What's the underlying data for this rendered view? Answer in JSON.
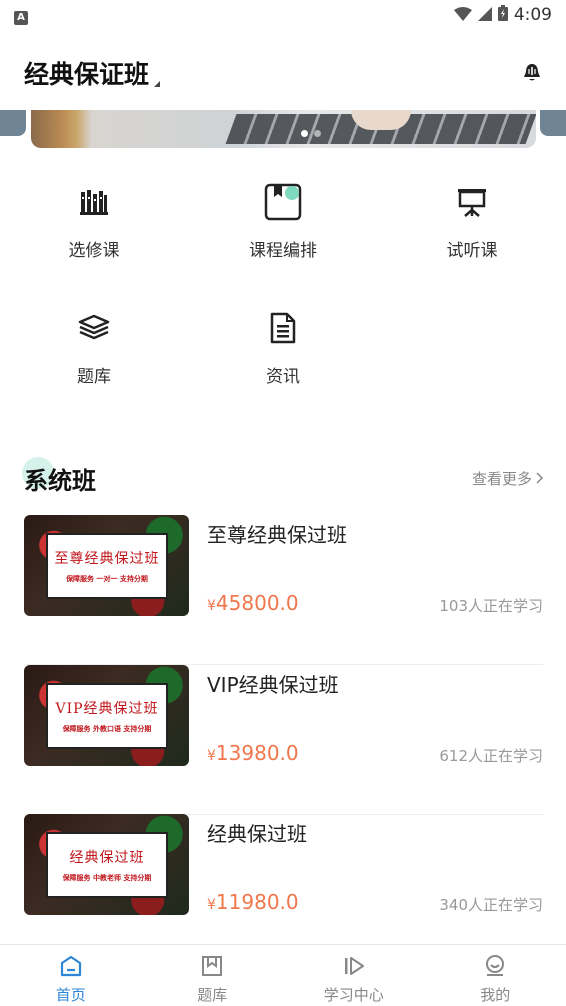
{
  "status_bar": {
    "app_badge": "A",
    "time": "4:09"
  },
  "header": {
    "title": "经典保证班"
  },
  "banner": {
    "slide_count": 2,
    "active_index": 0
  },
  "menu": [
    {
      "label": "选修课",
      "icon": "books-icon"
    },
    {
      "label": "课程编排",
      "icon": "schedule-bookmark-icon"
    },
    {
      "label": "试听课",
      "icon": "presentation-icon"
    },
    {
      "label": "题库",
      "icon": "stack-icon"
    },
    {
      "label": "资讯",
      "icon": "document-icon"
    }
  ],
  "section": {
    "title": "系统班",
    "more_label": "查看更多"
  },
  "courses": [
    {
      "name": "至尊经典保过班",
      "currency": "¥",
      "price": "45800.0",
      "learners": "103人正在学习",
      "thumb_main": "至尊经典保过班",
      "thumb_sub": "保障服务 一对一 支持分期"
    },
    {
      "name": "VIP经典保过班",
      "currency": "¥",
      "price": "13980.0",
      "learners": "612人正在学习",
      "thumb_main": "VIP经典保过班",
      "thumb_sub": "保障服务 外教口语 支持分期"
    },
    {
      "name": "经典保过班",
      "currency": "¥",
      "price": "11980.0",
      "learners": "340人正在学习",
      "thumb_main": "经典保过班",
      "thumb_sub": "保障服务 中教老师 支持分期"
    }
  ],
  "bottom_nav": [
    {
      "label": "首页",
      "icon": "home-icon",
      "active": true
    },
    {
      "label": "题库",
      "icon": "bookmark-icon",
      "active": false
    },
    {
      "label": "学习中心",
      "icon": "play-center-icon",
      "active": false
    },
    {
      "label": "我的",
      "icon": "profile-icon",
      "active": false
    }
  ],
  "colors": {
    "accent": "#2f86d6",
    "price": "#f0774b",
    "section_accent": "#d4f1ea"
  }
}
